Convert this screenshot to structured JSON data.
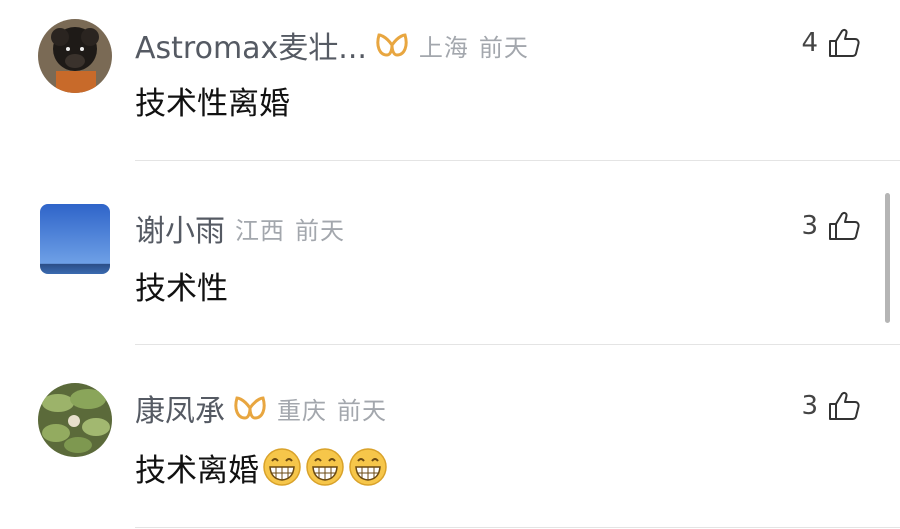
{
  "comments": [
    {
      "username": "Astromax麦壮...",
      "location": "上海",
      "time": "前天",
      "text": "技术性离婚",
      "likes": "4",
      "vip_badge": true,
      "avatar_icon": "dog-photo-avatar"
    },
    {
      "username": "谢小雨",
      "location": "江西",
      "time": "前天",
      "text": "技术性",
      "likes": "3",
      "vip_badge": false,
      "avatar_icon": "sky-photo-avatar"
    },
    {
      "username": "康凤承",
      "location": "重庆",
      "time": "前天",
      "text": "技术离婚",
      "likes": "3",
      "vip_badge": true,
      "avatar_icon": "lotus-photo-avatar",
      "emojis": [
        "grinning-emoji",
        "grinning-emoji",
        "grinning-emoji"
      ]
    }
  ],
  "colors": {
    "username": "#555a63",
    "meta": "#a3a7ad",
    "vip_gold": "#e8a640"
  }
}
